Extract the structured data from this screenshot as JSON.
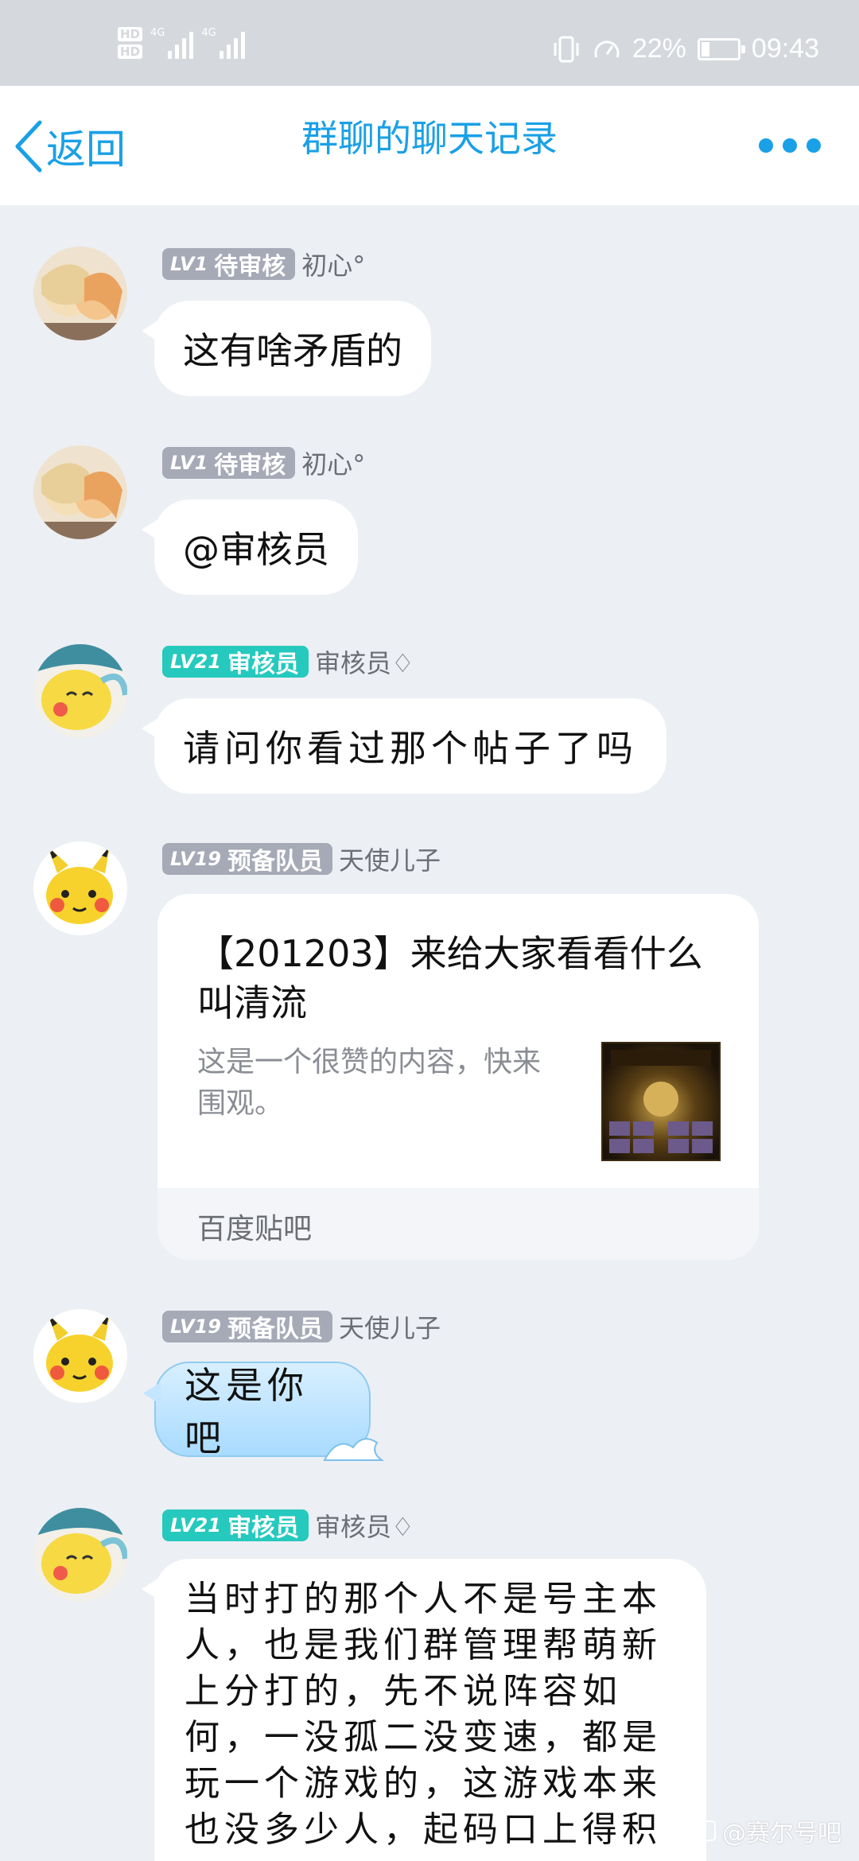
{
  "status_bar": {
    "hd1": "HD",
    "hd2": "HD",
    "net1": "4G",
    "net2": "4G",
    "battery_percent": "22%",
    "battery_level": 0.22,
    "time": "09:43"
  },
  "header": {
    "back_label": "返回",
    "title": "群聊的聊天记录"
  },
  "messages": [
    {
      "level": "LV1",
      "role": "待审核",
      "nickname": "初心°",
      "text": "这有啥矛盾的"
    },
    {
      "level": "LV1",
      "role": "待审核",
      "nickname": "初心°",
      "text": "@审核员"
    },
    {
      "level": "LV21",
      "role": "审核员",
      "nickname": "审核员♢",
      "text": "请问你看过那个帖子了吗"
    },
    {
      "level": "LV19",
      "role": "预备队员",
      "nickname": "天使儿子",
      "card": {
        "title": "【201203】来给大家看看什么叫清流",
        "description": "这是一个很赞的内容，快来围观。",
        "source": "百度贴吧"
      }
    },
    {
      "level": "LV19",
      "role": "预备队员",
      "nickname": "天使儿子",
      "text": "这是你吧"
    },
    {
      "level": "LV21",
      "role": "审核员",
      "nickname": "审核员♢",
      "text": "当时打的那个人不是号主本人，也是我们群管理帮萌新上分打的，先不说阵容如何，一没孤二没变速，都是玩一个游戏的，这游戏本来也没多少人，起码口上得积"
    }
  ],
  "watermark": "@赛尔号吧"
}
